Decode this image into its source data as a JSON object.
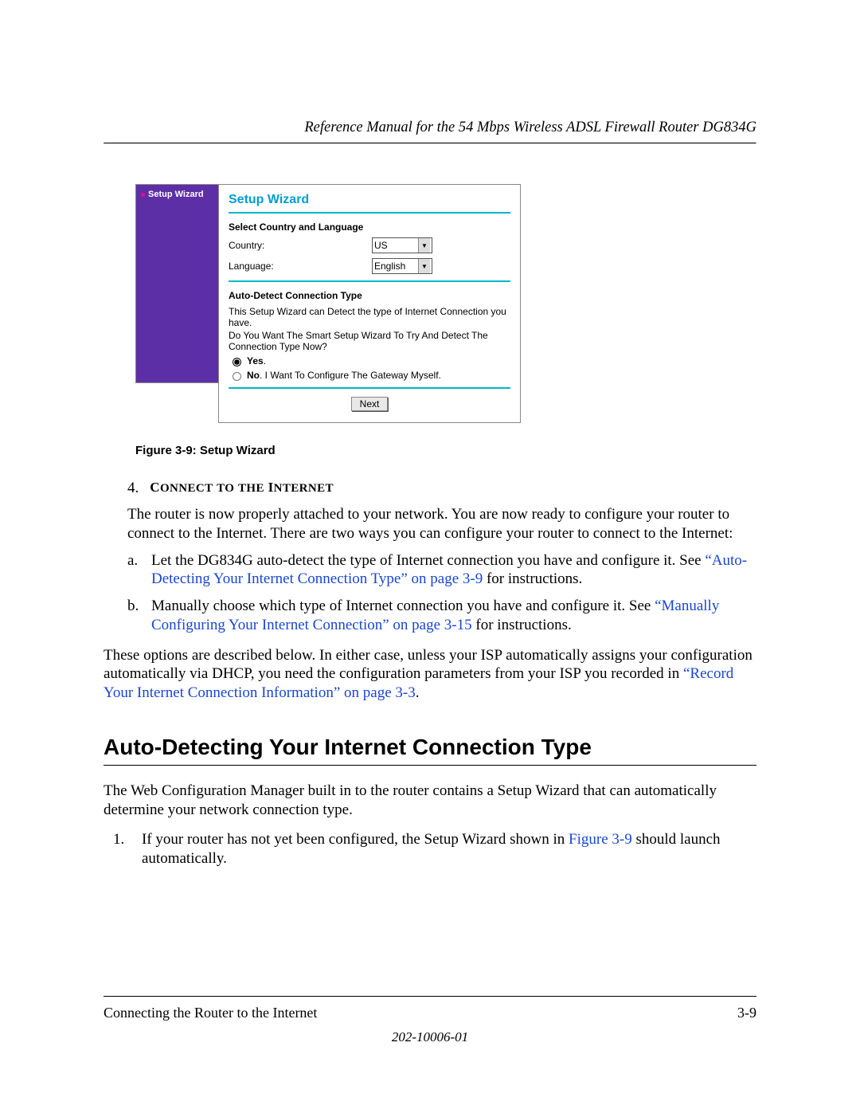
{
  "header": {
    "title": "Reference Manual for the 54 Mbps Wireless ADSL Firewall Router DG834G"
  },
  "wizard": {
    "sidebar_item": "Setup Wizard",
    "panel_title": "Setup Wizard",
    "section1_label": "Select Country and Language",
    "country_label": "Country:",
    "country_value": "US",
    "language_label": "Language:",
    "language_value": "English",
    "section2_label": "Auto-Detect Connection Type",
    "desc1": "This Setup Wizard can Detect the type of Internet Connection you have.",
    "desc2": "Do You Want The Smart Setup Wizard To Try And Detect The Connection Type Now?",
    "opt_yes_bold": "Yes",
    "opt_yes_tail": ".",
    "opt_no_bold": "No",
    "opt_no_tail": ". I Want To Configure The Gateway Myself.",
    "next_label": "Next"
  },
  "caption": "Figure 3-9:  Setup Wizard",
  "step4": {
    "num": "4.",
    "head": "Connect to the Internet",
    "para": "The router is now properly attached to your network. You are now ready to configure your router to connect to the Internet. There are two ways you can configure your router to connect to the Internet:",
    "a_letter": "a.",
    "a_pre": "Let the DG834G auto-detect the type of Internet connection you have and configure it. See ",
    "a_link": "“Auto-Detecting Your Internet Connection Type” on page 3-9",
    "a_post": " for instructions.",
    "b_letter": "b.",
    "b_pre": "Manually choose which type of Internet connection you have and configure it. See ",
    "b_link": "“Manually Configuring Your Internet Connection” on page 3-15",
    "b_post": " for instructions."
  },
  "options_para_pre": "These options are described below. In either case, unless your ISP automatically assigns your configuration automatically via DHCP, you need the configuration parameters from your ISP you recorded in ",
  "options_para_link": "“Record Your Internet Connection Information” on page 3-3",
  "options_para_post": ".",
  "section_heading": "Auto-Detecting Your Internet Connection Type",
  "section_para": "The Web Configuration Manager built in to the router contains a Setup Wizard that can automatically determine your network connection type.",
  "list1": {
    "num": "1.",
    "pre": "If your router has not yet been configured, the Setup Wizard shown in ",
    "link": "Figure 3-9",
    "post": " should launch automatically."
  },
  "footer": {
    "left": "Connecting the Router to the Internet",
    "right": "3-9",
    "doc": "202-10006-01"
  }
}
